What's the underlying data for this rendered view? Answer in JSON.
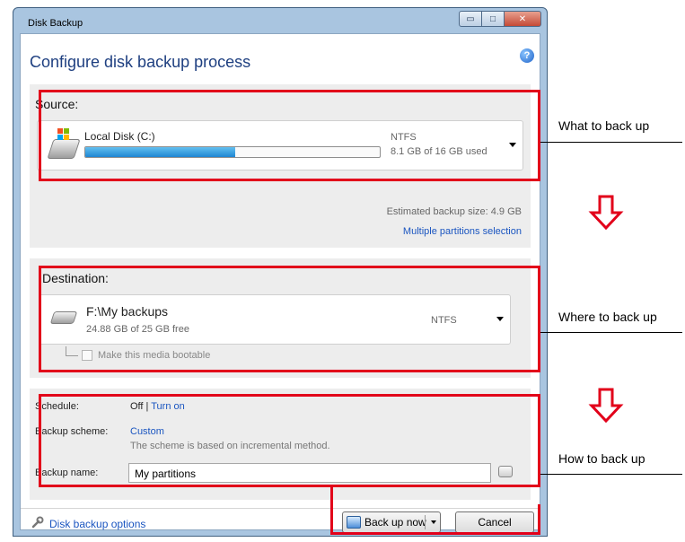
{
  "window": {
    "title": "Disk Backup",
    "minimize_glyph": "▭",
    "maximize_glyph": "□",
    "close_glyph": "✕"
  },
  "header": {
    "title": "Configure disk backup process",
    "help_glyph": "?"
  },
  "source": {
    "label": "Source:",
    "disk_name": "Local Disk (C:)",
    "filesystem": "NTFS",
    "usage_text": "8.1 GB of 16 GB used",
    "used_fraction": 0.51,
    "estimated_size": "Estimated backup size: 4.9 GB",
    "multiple_partitions_link": "Multiple partitions selection"
  },
  "destination": {
    "label": "Destination:",
    "path": "F:\\My backups",
    "free_text": "24.88 GB of 25 GB free",
    "filesystem": "NTFS",
    "bootable_label": "Make this media bootable"
  },
  "options": {
    "schedule_label": "Schedule:",
    "schedule_value": "Off |",
    "schedule_link": "Turn on",
    "scheme_label": "Backup scheme:",
    "scheme_value": "Custom",
    "scheme_desc": "The scheme is based on incremental method.",
    "name_label": "Backup name:",
    "name_value": "My partitions"
  },
  "footer": {
    "options_link": "Disk backup options",
    "backup_now_label": "Back up now",
    "cancel_label": "Cancel"
  },
  "annotations": {
    "what": "What to back up",
    "where": "Where to back up",
    "how": "How to back up"
  },
  "colors": {
    "annotation_red": "#e2001a",
    "link_blue": "#1a55c0",
    "title_blue": "#1e3f80",
    "progress_blue": "#1f86d2"
  }
}
